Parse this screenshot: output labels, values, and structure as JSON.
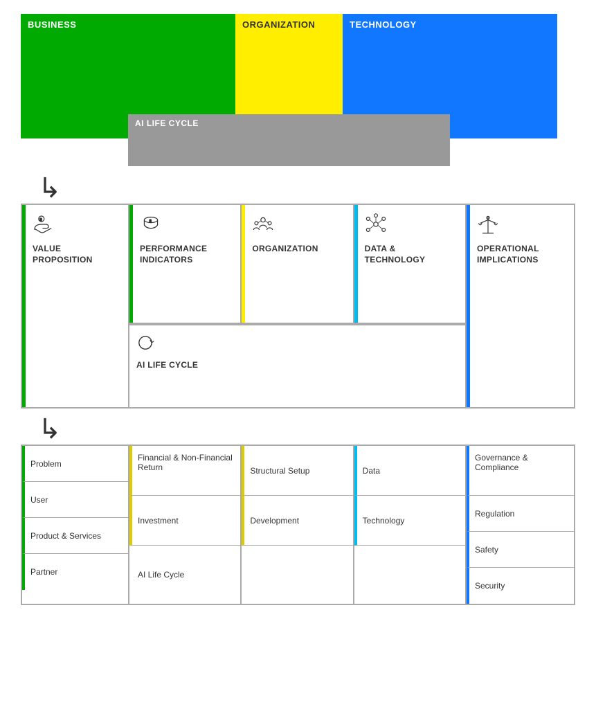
{
  "top": {
    "business_label": "BUSINESS",
    "organization_label": "ORGANIZATION",
    "technology_label": "TECHNOLOGY",
    "ai_lifecycle_label": "AI LIFE CYCLE"
  },
  "mid": {
    "col1_label": "VALUE PROPOSITION",
    "col2_label": "PERFORMANCE INDICATORS",
    "col3_label": "ORGANIZATION",
    "col4_label": "DATA & TECHNOLOGY",
    "col5_label": "OPERATIONAL IMPLICATIONS",
    "lifecycle_label": "AI LIFE CYCLE"
  },
  "bottom": {
    "col1": {
      "cells": [
        "Problem",
        "User",
        "Product & Services",
        "Partner"
      ]
    },
    "col2": {
      "cells": [
        "Financial & Non-Financial Return",
        "Investment"
      ]
    },
    "col3": {
      "cells": [
        "Structural Setup",
        "Development"
      ]
    },
    "col4": {
      "cells": [
        "Data",
        "Technology"
      ]
    },
    "col5": {
      "cells": [
        "Governance & Compliance",
        "Regulation",
        "Safety",
        "Security"
      ]
    },
    "lifecycle_label": "AI Life Cycle"
  },
  "colors": {
    "green": "#00aa00",
    "yellow": "#ffee00",
    "blue": "#1177ff",
    "cyan": "#00bbee",
    "gray": "#999999"
  }
}
